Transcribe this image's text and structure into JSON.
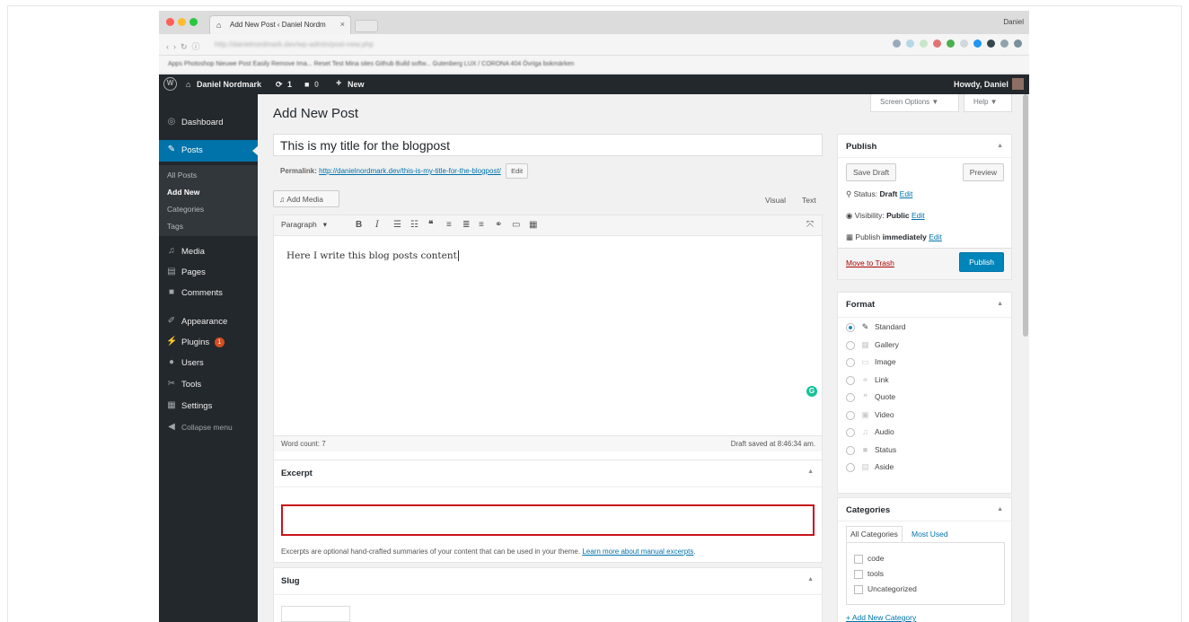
{
  "browser": {
    "tab_title": "Add New Post ‹ Daniel Nordm",
    "tab_close": "×",
    "user_name": "Daniel",
    "url": "http://danielnordmark.dev/wp-admin/post-new.php",
    "bookmarks": "Apps   Photoshop   Nieuwe Post   Easily Remove Ima...   Reset   Test   Mina sites   Github   Build softw...   Gutenberg   LUX / CORONA 404   Övriga bokmärken"
  },
  "adminbar": {
    "site_name": "Daniel Nordmark",
    "updates_count": "1",
    "comments_count": "0",
    "new_label": "New",
    "howdy": "Howdy, Daniel"
  },
  "sidebar": {
    "items": [
      {
        "label": "Dashboard",
        "icon": "dashboard-icon"
      },
      {
        "label": "Posts",
        "icon": "pushpin-icon"
      },
      {
        "label": "Media",
        "icon": "media-icon"
      },
      {
        "label": "Pages",
        "icon": "pages-icon"
      },
      {
        "label": "Comments",
        "icon": "comments-icon"
      },
      {
        "label": "Appearance",
        "icon": "appearance-icon"
      },
      {
        "label": "Plugins",
        "icon": "plugins-icon",
        "badge": "1"
      },
      {
        "label": "Users",
        "icon": "users-icon"
      },
      {
        "label": "Tools",
        "icon": "tools-icon"
      },
      {
        "label": "Settings",
        "icon": "settings-icon"
      },
      {
        "label": "Collapse menu",
        "icon": "collapse-icon"
      }
    ],
    "posts_submenu": [
      "All Posts",
      "Add New",
      "Categories",
      "Tags"
    ]
  },
  "header": {
    "screen_options": "Screen Options ▼",
    "help": "Help ▼",
    "page_title": "Add New Post"
  },
  "post": {
    "title": "This is my title for the blogpost",
    "permalink_label": "Permalink:",
    "permalink_url": "http://danielnordmark.dev/this-is-my-title-for-the-blogpost/",
    "edit_button": "Edit",
    "add_media": "Add Media",
    "tab_visual": "Visual",
    "tab_text": "Text",
    "paragraph_select": "Paragraph",
    "content": "Here I write this blog posts content",
    "word_count": "Word count: 7",
    "draft_saved": "Draft saved at 8:46:34 am."
  },
  "excerpt": {
    "title": "Excerpt",
    "value": "",
    "help_text": "Excerpts are optional hand-crafted summaries of your content that can be used in your theme.",
    "help_link": "Learn more about manual excerpts",
    "highlight_color": "#c8131a"
  },
  "slug": {
    "title": "Slug",
    "value": ""
  },
  "publish": {
    "title": "Publish",
    "save_draft": "Save Draft",
    "preview": "Preview",
    "status_label": "Status:",
    "status_value": "Draft",
    "visibility_label": "Visibility:",
    "visibility_value": "Public",
    "publish_label": "Publish",
    "publish_value": "immediately",
    "edit": "Edit",
    "move_to_trash": "Move to Trash",
    "publish_button": "Publish",
    "publish_color": "#0085ba"
  },
  "format": {
    "title": "Format",
    "options": [
      {
        "label": "Standard",
        "selected": true,
        "icon": "pushpin-icon"
      },
      {
        "label": "Gallery",
        "selected": false,
        "icon": "gallery-icon"
      },
      {
        "label": "Image",
        "selected": false,
        "icon": "image-icon"
      },
      {
        "label": "Link",
        "selected": false,
        "icon": "link-icon"
      },
      {
        "label": "Quote",
        "selected": false,
        "icon": "quote-icon"
      },
      {
        "label": "Video",
        "selected": false,
        "icon": "video-icon"
      },
      {
        "label": "Audio",
        "selected": false,
        "icon": "audio-icon"
      },
      {
        "label": "Status",
        "selected": false,
        "icon": "status-icon"
      },
      {
        "label": "Aside",
        "selected": false,
        "icon": "aside-icon"
      }
    ]
  },
  "categories": {
    "title": "Categories",
    "tab_all": "All Categories",
    "tab_most_used": "Most Used",
    "items": [
      "code",
      "tools",
      "Uncategorized"
    ],
    "add_new": "+ Add New Category"
  },
  "colors": {
    "admin_dark": "#23282d",
    "accent": "#0073aa",
    "background": "#f1f1f1"
  }
}
